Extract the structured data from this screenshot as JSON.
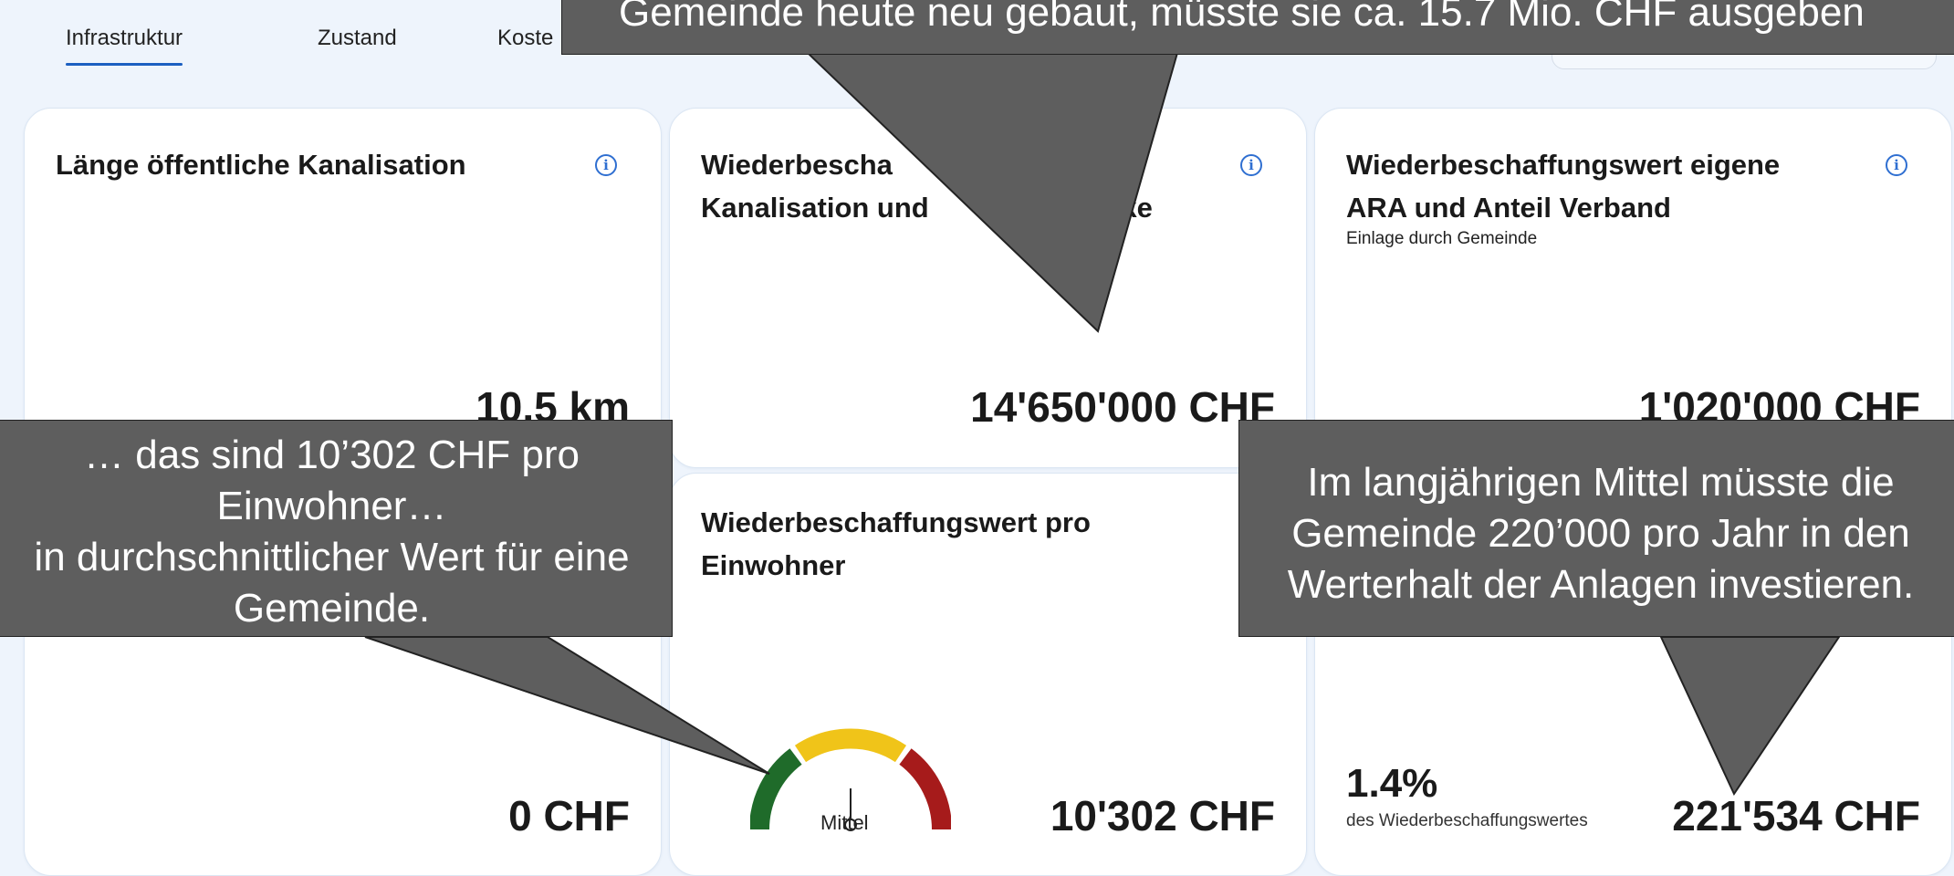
{
  "tabs": [
    {
      "label": "Infrastruktur",
      "active": true
    },
    {
      "label": "Zustand",
      "active": false
    },
    {
      "label": "Koste",
      "active": false
    }
  ],
  "cards": {
    "length": {
      "title": "Länge öffentliche Kanalisation",
      "value": "10.5 km",
      "bottom_value": "0 CHF"
    },
    "replacement": {
      "title_line1": "Wiederbescha",
      "title_line2_a": "Kanalisation und",
      "title_line2_b": "werke",
      "value": "14'650'000 CHF"
    },
    "ara": {
      "title_line1": "Wiederbeschaffungswert eigene",
      "title_line2": "ARA und Anteil Verband",
      "subtitle": "Einlage durch Gemeinde",
      "value": "1'020'000 CHF"
    },
    "per_capita": {
      "title_line1": "Wiederbeschaffungswert pro",
      "title_line2": "Einwohner",
      "gauge_label": "Mittel",
      "gauge_level": "Mittel",
      "value": "10'302 CHF"
    },
    "annual": {
      "percent": "1.4%",
      "percent_sub": "des Wiederbeschaffungswertes",
      "value": "221'534 CHF"
    }
  },
  "gauge_colors": {
    "low": "#1f6b2a",
    "mid": "#f0c419",
    "high": "#a61b1b"
  },
  "callouts": {
    "top": "Gemeinde heute neu gebaut, müsste sie ca. 15.7 Mio. CHF ausgeben",
    "left_line1": "… das sind 10’302 CHF pro",
    "left_line2": "Einwohner…",
    "left_line3": "in durchschnittlicher Wert für eine",
    "left_line4": "Gemeinde.",
    "right_line1": "Im langjährigen Mittel müsste die",
    "right_line2": "Gemeinde 220’000 pro Jahr in den",
    "right_line3": "Werterhalt der Anlagen investieren."
  },
  "colors": {
    "accent": "#1b5fc1",
    "callout_bg": "#5e5e5e",
    "card_bg": "#ffffff",
    "page_bg": "#eef4fc"
  }
}
